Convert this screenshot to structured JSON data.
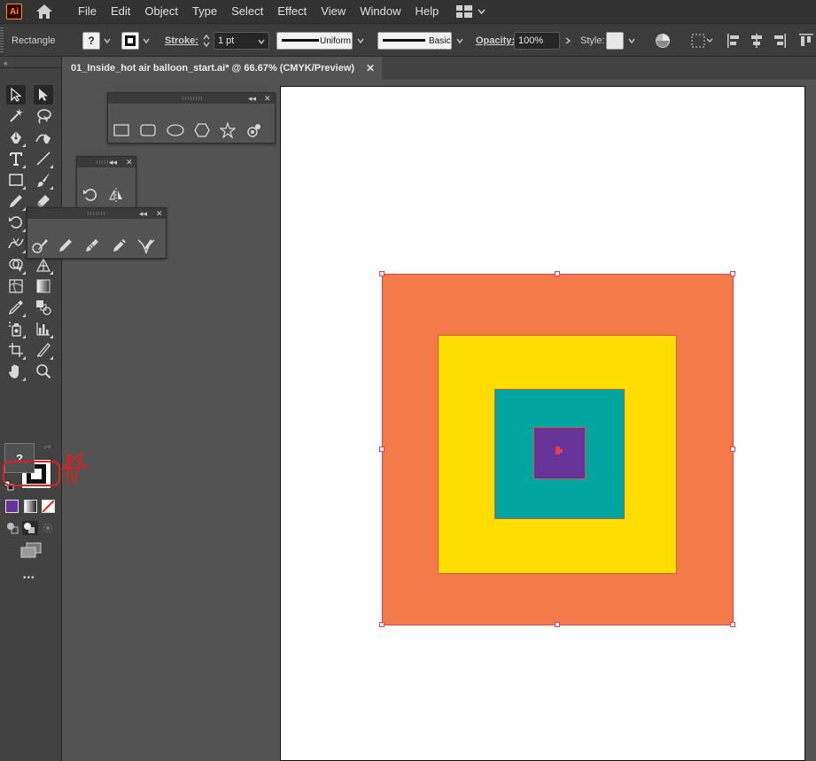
{
  "app": {
    "logo_text": "Ai",
    "menu": [
      "File",
      "Edit",
      "Object",
      "Type",
      "Select",
      "Effect",
      "View",
      "Window",
      "Help"
    ]
  },
  "controlbar": {
    "tool_name": "Rectangle",
    "fill_label": "?",
    "stroke_label": "Stroke:",
    "stroke_weight": "1 pt",
    "profile_label": "Uniform",
    "brush_label": "Basic",
    "opacity_label": "Opacity:",
    "opacity_value": "100%",
    "style_label": "Style:"
  },
  "document": {
    "tab_title": "01_Inside_hot air balloon_start.ai* @ 66.67% (CMYK/Preview)",
    "close_glyph": "✕"
  },
  "toolbar": {
    "collapse_glyph": "«",
    "fill_question": "?",
    "more_glyph": "•••"
  },
  "colors": {
    "outer_square": "#F47A4A",
    "yellow_square": "#FFDD00",
    "teal_square": "#00A59F",
    "purple_square": "#663399",
    "selection": "#E04050",
    "annotation": "#E02020",
    "active_fill_swatch": "#663399"
  },
  "panels": {
    "shapes": {
      "collapse": "◂◂",
      "close": "✕",
      "icons": [
        "rectangle-icon",
        "rounded-rectangle-icon",
        "ellipse-icon",
        "polygon-icon",
        "star-icon",
        "flare-icon"
      ]
    },
    "rotate": {
      "collapse": "◂◂",
      "close": "✕",
      "icons": [
        "rotate-icon",
        "reflect-icon"
      ]
    },
    "brush": {
      "collapse": "◂◂",
      "close": "✕",
      "icons": [
        "shaper-icon",
        "pencil-icon",
        "smooth-icon",
        "path-eraser-icon",
        "join-icon"
      ]
    }
  }
}
